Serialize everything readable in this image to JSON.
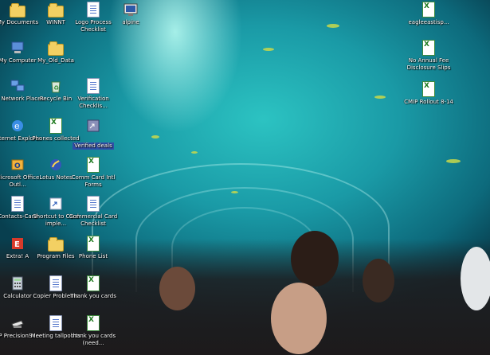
{
  "desktop": {
    "wallpaper": "aquarium-tunnel",
    "accent_selected": "#2f4fa8",
    "icons": [
      {
        "label": "My Documents",
        "icon": "documents-folder-icon"
      },
      {
        "label": "WINNT",
        "icon": "folder-icon"
      },
      {
        "label": "Logo Process Checklist",
        "icon": "word-document-icon"
      },
      {
        "label": "alpine",
        "icon": "alpine-app-icon"
      },
      {
        "label": "My Computer",
        "icon": "computer-icon"
      },
      {
        "label": "My_Old_Data",
        "icon": "folder-icon"
      },
      {
        "label": "My Network Places",
        "icon": "network-icon"
      },
      {
        "label": "Recycle Bin",
        "icon": "recycle-bin-icon"
      },
      {
        "label": "Verification Checklis...",
        "icon": "word-document-icon"
      },
      {
        "label": "Internet Explorer",
        "icon": "internet-explorer-icon"
      },
      {
        "label": "Phones collected",
        "icon": "excel-document-icon"
      },
      {
        "label": "Verified deals",
        "icon": "shortcut-icon"
      },
      {
        "label": "Microsoft Office Outl...",
        "icon": "outlook-icon"
      },
      {
        "label": "Lotus Notes",
        "icon": "lotus-notes-icon"
      },
      {
        "label": "Comm Card Intl Forms",
        "icon": "excel-document-icon"
      },
      {
        "label": "Contacts-Card",
        "icon": "word-document-icon"
      },
      {
        "label": "Shortcut to Card imple...",
        "icon": "shortcut-icon"
      },
      {
        "label": "Commercial Card Checklist",
        "icon": "word-document-icon"
      },
      {
        "label": "Extra! A",
        "icon": "extra-terminal-icon"
      },
      {
        "label": "Program Files",
        "icon": "folder-icon"
      },
      {
        "label": "Phone List",
        "icon": "excel-document-icon"
      },
      {
        "label": "Calculator",
        "icon": "calculator-icon"
      },
      {
        "label": "Copier Problems",
        "icon": "word-document-icon"
      },
      {
        "label": "Thank you cards",
        "icon": "excel-document-icon"
      },
      {
        "label": "HP PrecisionSc...",
        "icon": "scanner-icon"
      },
      {
        "label": "Meeting tallpoints",
        "icon": "word-document-icon"
      },
      {
        "label": "thank you cards (need...",
        "icon": "excel-document-icon"
      },
      {
        "label": "eagleeastisp...",
        "icon": "excel-document-icon"
      },
      {
        "label": "No Annual Fee Disclosure Slips",
        "icon": "excel-document-icon"
      },
      {
        "label": "CMIP Rollout 8-14",
        "icon": "excel-document-icon"
      }
    ],
    "selected_label": "Verified deals"
  }
}
